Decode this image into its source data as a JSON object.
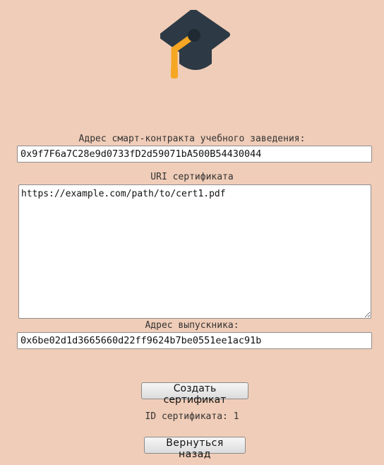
{
  "logo": {
    "icon": "graduation-cap-icon",
    "colors": {
      "cap": "#2d3a45",
      "tassel": "#f5a623"
    }
  },
  "form": {
    "contract_label": "Адрес смарт-контракта учебного заведения:",
    "contract_value": "0x9f7F6a7C28e9d0733fD2d59071bA500B54430044",
    "uri_label": "URI сертификата",
    "uri_value": "https://example.com/path/to/cert1.pdf",
    "graduate_label": "Адрес выпускника:",
    "graduate_value": "0x6be02d1d3665660d22ff9624b7be0551ee1ac91b",
    "create_button": "Создать сертификат"
  },
  "result": {
    "cert_id_label": "ID сертификата:",
    "cert_id_value": "1"
  },
  "navigation": {
    "back_button": "Вернуться назад"
  },
  "colors": {
    "background": "#f0cdb8"
  }
}
